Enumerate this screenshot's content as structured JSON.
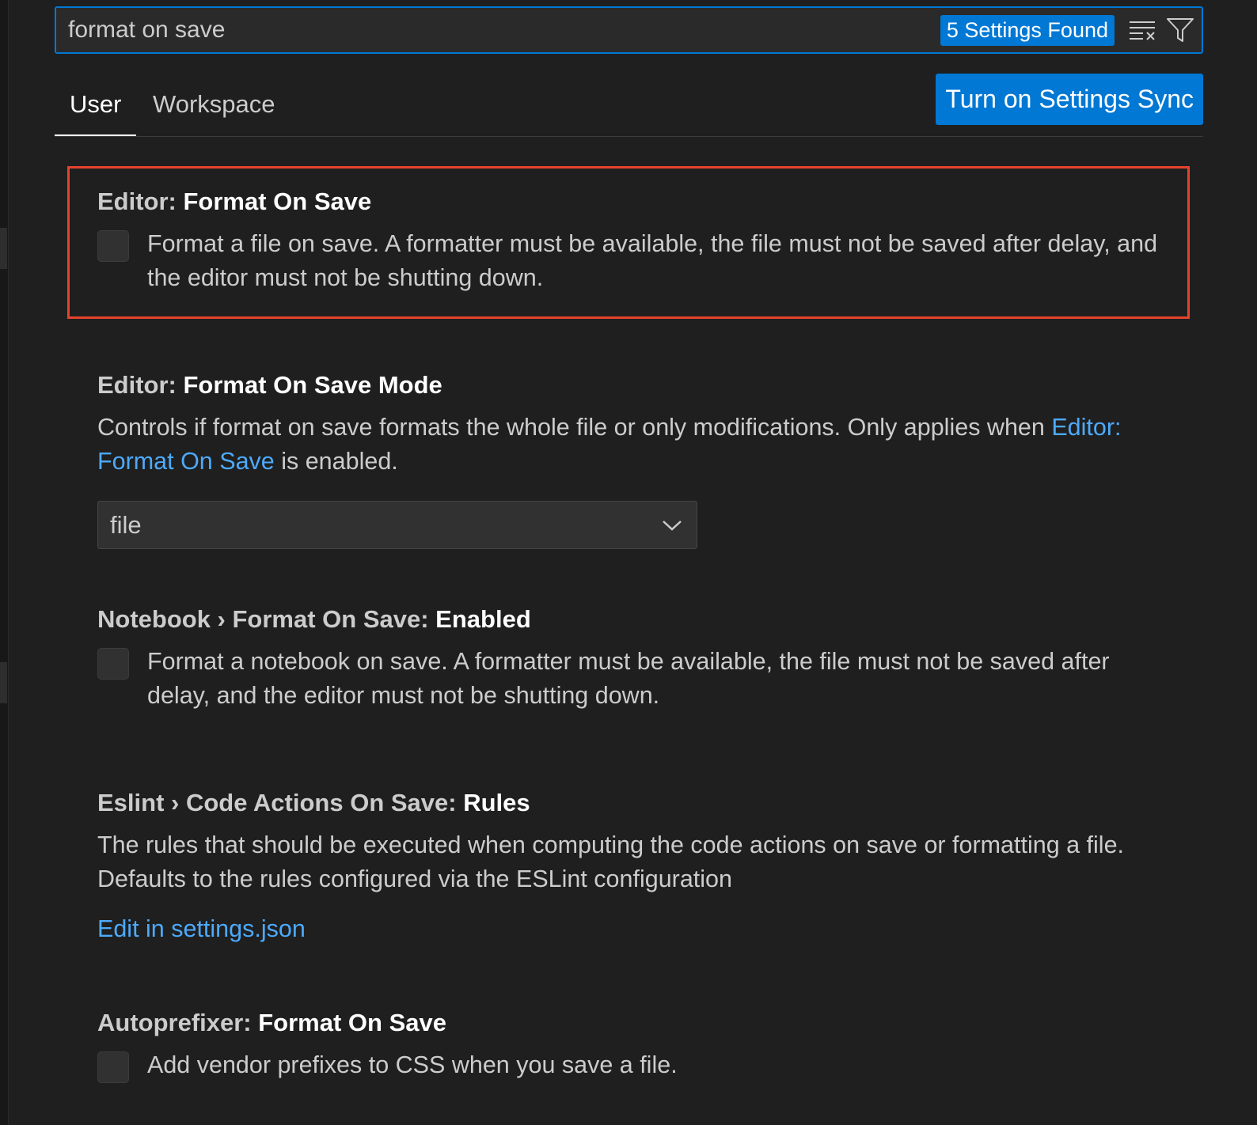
{
  "search": {
    "value": "format on save",
    "results_badge": "5 Settings Found",
    "clear_icon": "clear-filter-icon",
    "filter_icon": "filter-icon"
  },
  "tabs": [
    {
      "label": "User",
      "active": true
    },
    {
      "label": "Workspace",
      "active": false
    }
  ],
  "sync_button": "Turn on Settings Sync",
  "settings": {
    "format_on_save": {
      "category": "Editor: ",
      "name": "Format On Save",
      "description": "Format a file on save. A formatter must be available, the file must not be saved after delay, and the editor must not be shutting down.",
      "checked": false
    },
    "format_on_save_mode": {
      "category": "Editor: ",
      "name": "Format On Save Mode",
      "description_before": "Controls if format on save formats the whole file or only modifications. Only applies when ",
      "description_link": "Editor: Format On Save",
      "description_after": " is enabled.",
      "selected_value": "file"
    },
    "notebook_format_on_save": {
      "category": "Notebook › Format On Save: ",
      "name": "Enabled",
      "description": "Format a notebook on save. A formatter must be available, the file must not be saved after delay, and the editor must not be shutting down.",
      "checked": false
    },
    "eslint_rules": {
      "category": "Eslint › Code Actions On Save: ",
      "name": "Rules",
      "description": "The rules that should be executed when computing the code actions on save or formatting a file. Defaults to the rules configured via the ESLint configuration",
      "edit_link": "Edit in settings.json"
    },
    "autoprefixer": {
      "category": "Autoprefixer: ",
      "name": "Format On Save",
      "description": "Add vendor prefixes to CSS when you save a file.",
      "checked": false
    }
  },
  "colors": {
    "accent": "#0078d4",
    "link": "#4daafc",
    "highlight_border": "#e5432d",
    "background": "#1f1f1f"
  }
}
